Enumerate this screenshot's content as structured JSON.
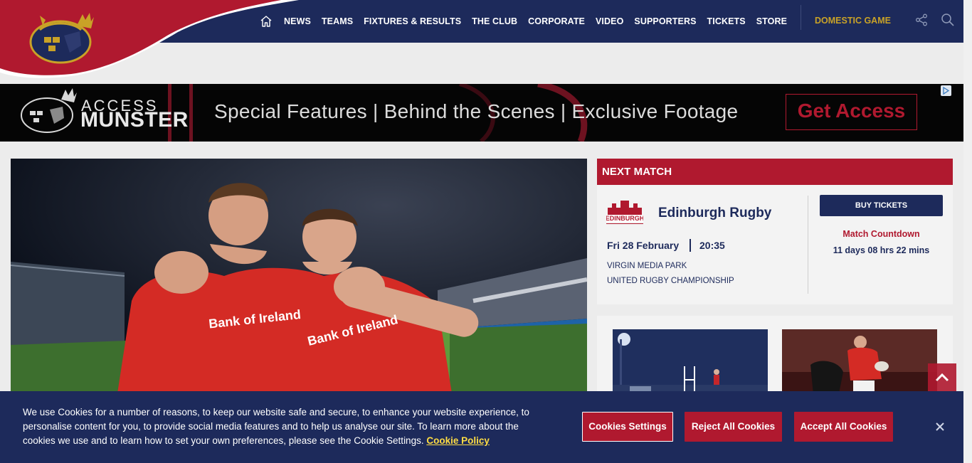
{
  "header": {
    "nav_items": [
      "NEWS",
      "TEAMS",
      "FIXTURES & RESULTS",
      "THE CLUB",
      "CORPORATE",
      "VIDEO",
      "SUPPORTERS",
      "TICKETS",
      "STORE"
    ],
    "domestic_label": "DOMESTIC GAME",
    "colors": {
      "navy": "#1d2a5b",
      "red": "#b0192f",
      "gold": "#c9a227"
    }
  },
  "ad": {
    "brand_line1": "ACCESS",
    "brand_line2": "MUNSTER",
    "tagline": "Special Features | Behind the Scenes | Exclusive Footage",
    "cta": "Get Access"
  },
  "next_match": {
    "heading": "NEXT MATCH",
    "opponent": "Edinburgh Rugby",
    "date": "Fri 28 February",
    "time": "20:35",
    "venue": "VIRGIN MEDIA PARK",
    "competition": "UNITED RUGBY CHAMPIONSHIP",
    "buy_tickets": "BUY TICKETS",
    "countdown_label": "Match Countdown",
    "countdown_value": "11 days 08 hrs 22 mins"
  },
  "hero": {
    "sponsor_text": "Bank of Ireland"
  },
  "cookie": {
    "text": "We use Cookies for a number of reasons, to keep our website safe and secure, to enhance your website experience, to personalise content for you, to provide social media features and to help us analyse our site. To learn more about the cookies we use and to learn how to set your own preferences, please see the Cookie Settings.",
    "policy_link": "Cookie Policy",
    "settings_btn": "Cookies Settings",
    "reject_btn": "Reject All Cookies",
    "accept_btn": "Accept All Cookies"
  }
}
